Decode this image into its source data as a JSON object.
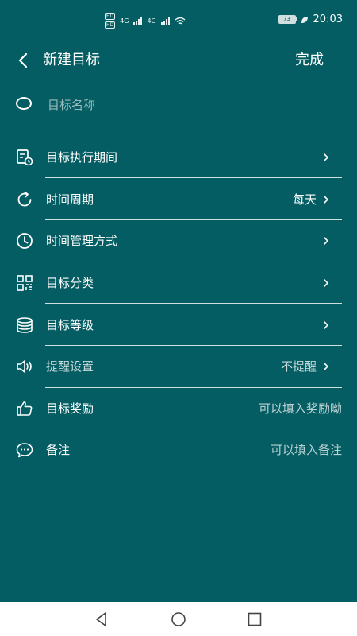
{
  "status_bar": {
    "hd1": "HD",
    "hd2": "HD",
    "net1": "4G",
    "net2": "4G",
    "battery": "73",
    "time": "20:03"
  },
  "header": {
    "title": "新建目标",
    "done_label": "完成"
  },
  "name_field": {
    "placeholder": "目标名称",
    "value": ""
  },
  "rows": [
    {
      "label": "目标执行期间",
      "value": "",
      "icon": "calendar-clock-icon"
    },
    {
      "label": "时间周期",
      "value": "每天",
      "icon": "repeat-icon"
    },
    {
      "label": "时间管理方式",
      "value": "",
      "icon": "clock-icon"
    },
    {
      "label": "目标分类",
      "value": "",
      "icon": "category-grid-icon"
    },
    {
      "label": "目标等级",
      "value": "",
      "icon": "layers-icon"
    },
    {
      "label": "提醒设置",
      "value": "不提醒",
      "icon": "speaker-icon"
    },
    {
      "label": "目标奖励",
      "value": "可以填入奖励呦",
      "icon": "thumbs-up-icon"
    },
    {
      "label": "备注",
      "value": "可以填入备注",
      "icon": "comment-icon"
    }
  ],
  "colors": {
    "background": "#035d63",
    "text": "#ffffff",
    "muted": "#c7d9da",
    "navbar": "#ffffff"
  }
}
